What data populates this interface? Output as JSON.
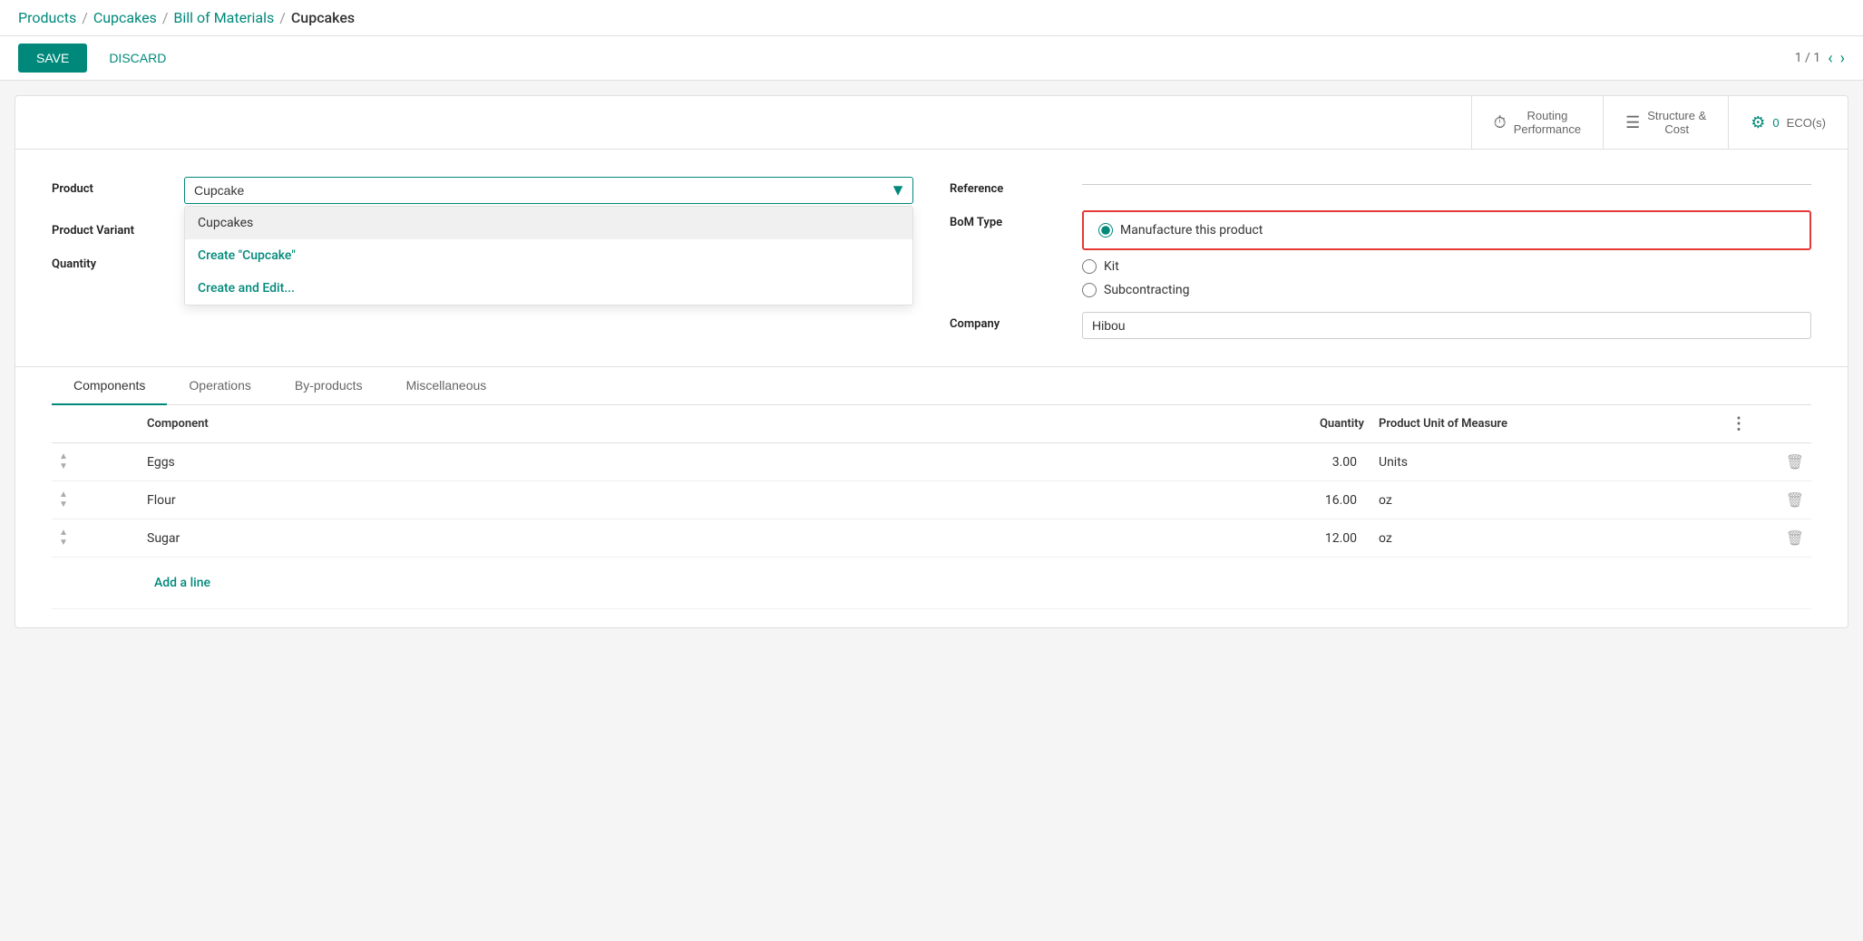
{
  "breadcrumb": {
    "items": [
      {
        "label": "Products",
        "type": "link"
      },
      {
        "label": "/",
        "type": "sep"
      },
      {
        "label": "Cupcakes",
        "type": "link"
      },
      {
        "label": "/",
        "type": "sep"
      },
      {
        "label": "Bill of Materials",
        "type": "link"
      },
      {
        "label": "/",
        "type": "sep"
      },
      {
        "label": "Cupcakes",
        "type": "active"
      }
    ]
  },
  "actions": {
    "save_label": "SAVE",
    "discard_label": "DISCARD",
    "pagination": "1 / 1"
  },
  "header_buttons": [
    {
      "label": "Routing\nPerformance",
      "icon": "⏱",
      "count": null,
      "key": "routing"
    },
    {
      "label": "Structure &\nCost",
      "icon": "☰",
      "count": null,
      "key": "structure"
    },
    {
      "label": "ECO(s)",
      "icon": "⚙",
      "count": "0",
      "key": "ecos"
    }
  ],
  "form": {
    "product_label": "Product",
    "product_value": "Cupcake",
    "product_variant_label": "Product Variant",
    "quantity_label": "Quantity",
    "reference_label": "Reference",
    "reference_placeholder": "",
    "bom_type_label": "BoM Type",
    "bom_options": [
      {
        "label": "Manufacture this product",
        "value": "manufacture",
        "selected": true
      },
      {
        "label": "Kit",
        "value": "kit",
        "selected": false
      },
      {
        "label": "Subcontracting",
        "value": "subcontracting",
        "selected": false
      }
    ],
    "company_label": "Company",
    "company_value": "Hibou"
  },
  "dropdown": {
    "items": [
      {
        "label": "Cupcakes",
        "type": "option"
      },
      {
        "label": "Create \"Cupcake\"",
        "type": "create"
      },
      {
        "label": "Create and Edit...",
        "type": "create"
      }
    ]
  },
  "tabs": [
    {
      "label": "Components",
      "active": true
    },
    {
      "label": "Operations",
      "active": false
    },
    {
      "label": "By-products",
      "active": false
    },
    {
      "label": "Miscellaneous",
      "active": false
    }
  ],
  "table": {
    "headers": [
      {
        "label": "Component",
        "key": "component"
      },
      {
        "label": "Quantity",
        "key": "quantity"
      },
      {
        "label": "Product Unit of Measure",
        "key": "uom"
      }
    ],
    "rows": [
      {
        "component": "Eggs",
        "quantity": "3.00",
        "uom": "Units"
      },
      {
        "component": "Flour",
        "quantity": "16.00",
        "uom": "oz"
      },
      {
        "component": "Sugar",
        "quantity": "12.00",
        "uom": "oz"
      }
    ],
    "add_line_label": "Add a line"
  }
}
